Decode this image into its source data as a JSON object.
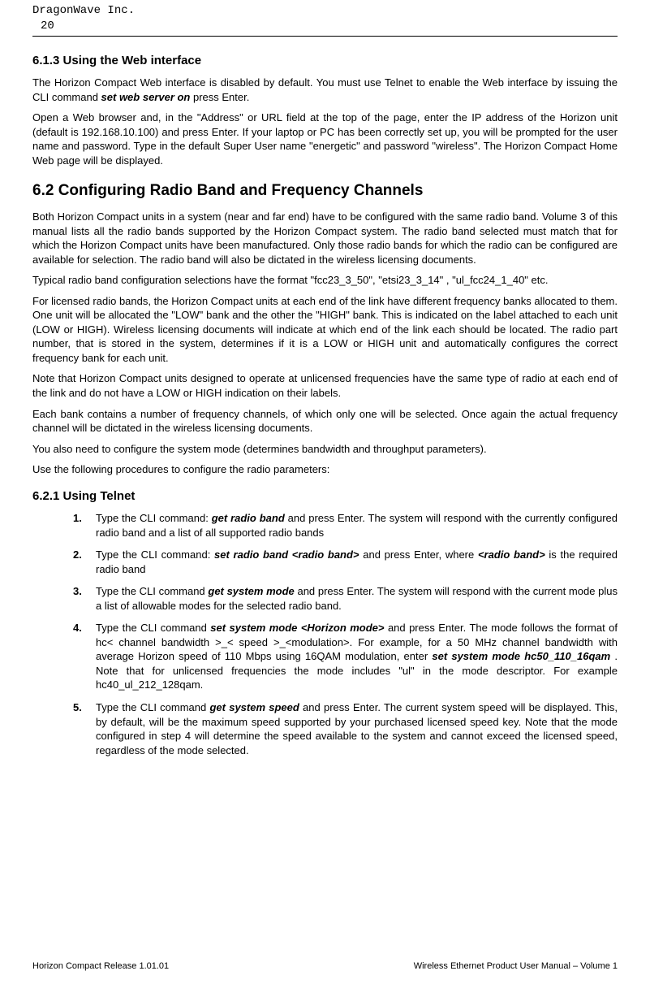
{
  "header": {
    "company": "DragonWave Inc.",
    "pagenum": "20"
  },
  "s613": {
    "heading": "6.1.3        Using the Web interface",
    "p1a": "The Horizon Compact Web interface is disabled by default. You must use Telnet to enable the Web interface by issuing the CLI command ",
    "p1cmd": "set web server on",
    "p1b": " press Enter.",
    "p2": "Open a Web browser and, in the \"Address\" or URL field at the top of the page, enter the IP address of the Horizon unit (default is 192.168.10.100) and press Enter. If your laptop or PC has been correctly set up, you will be prompted for the user name and password. Type in the default Super User name \"energetic\" and password \"wireless\". The Horizon Compact Home Web page will be displayed."
  },
  "s62": {
    "heading": "6.2      Configuring Radio Band and Frequency Channels",
    "p1": "Both Horizon Compact units in a system (near and far end) have to be configured with the same radio band. Volume 3 of this manual lists all the radio bands supported by the Horizon Compact system. The radio band selected must match that for which the Horizon Compact units have been manufactured. Only those radio bands for which the radio can be configured are available for selection. The radio band will also be dictated in the wireless licensing documents.",
    "p2": "Typical radio band configuration selections have the format \"fcc23_3_50\", \"etsi23_3_14\" , \"ul_fcc24_1_40\" etc.",
    "p3": "For licensed radio bands, the Horizon Compact units at each end of the link have different frequency banks allocated to them. One unit will be allocated the \"LOW\" bank and the other the \"HIGH\" bank. This is indicated on the label attached to each unit (LOW or HIGH). Wireless licensing documents will indicate at which end of the link each should be located. The radio part number, that is stored in the system, determines if it is a LOW or HIGH unit and automatically configures the correct frequency bank for each unit.",
    "p4": "Note that Horizon Compact units designed to operate at unlicensed frequencies have the same type of radio at each end of the link and do not have a LOW or HIGH indication on their labels.",
    "p5": "Each bank contains a number of frequency channels, of which only one will be selected. Once again the actual frequency channel will be dictated in the wireless licensing documents.",
    "p6": "You also need to configure the system mode (determines bandwidth and throughput parameters).",
    "p7": "Use the following procedures to configure the radio parameters:"
  },
  "s621": {
    "heading": "6.2.1        Using Telnet",
    "steps": {
      "n1": "1.",
      "t1a": "Type the CLI command: ",
      "t1cmd": "get radio band",
      "t1b": " and press Enter. The system will respond with the currently configured radio band and a list of all supported radio bands",
      "n2": "2.",
      "t2a": "Type the CLI command: ",
      "t2cmd": "set radio band <radio band>",
      "t2b": " and press Enter, where ",
      "t2arg": "<radio band>",
      "t2c": " is the required radio band",
      "n3": "3.",
      "t3a": "Type the CLI command ",
      "t3cmd": "get system mode",
      "t3b": " and press Enter.  The system will respond with the current mode plus a list of allowable modes for the selected radio band.",
      "n4": "4.",
      "t4a": "Type the CLI command  ",
      "t4cmd": "set system mode <Horizon mode>",
      "t4b": " and press Enter. The mode follows the format of hc< channel bandwidth >_< speed >_<modulation>.  For example, for a 50 MHz channel bandwidth with average Horizon speed of 110 Mbps using 16QAM modulation, enter  ",
      "t4cmd2": "set system mode hc50_110_16qam",
      "t4c": " . Note that for unlicensed frequencies the mode includes \"ul\" in the mode descriptor. For example hc40_ul_212_128qam.",
      "n5": "5.",
      "t5a": "Type the CLI command ",
      "t5cmd": "get system speed",
      "t5b": " and press Enter. The current system speed will be displayed. This, by default, will be the maximum speed supported by your purchased licensed speed key. Note that the mode configured in step 4 will determine the speed available to the system and cannot exceed the licensed speed, regardless of the mode selected."
    }
  },
  "footer": {
    "left": "Horizon Compact Release 1.01.01",
    "right": "Wireless Ethernet Product User Manual – Volume 1"
  }
}
